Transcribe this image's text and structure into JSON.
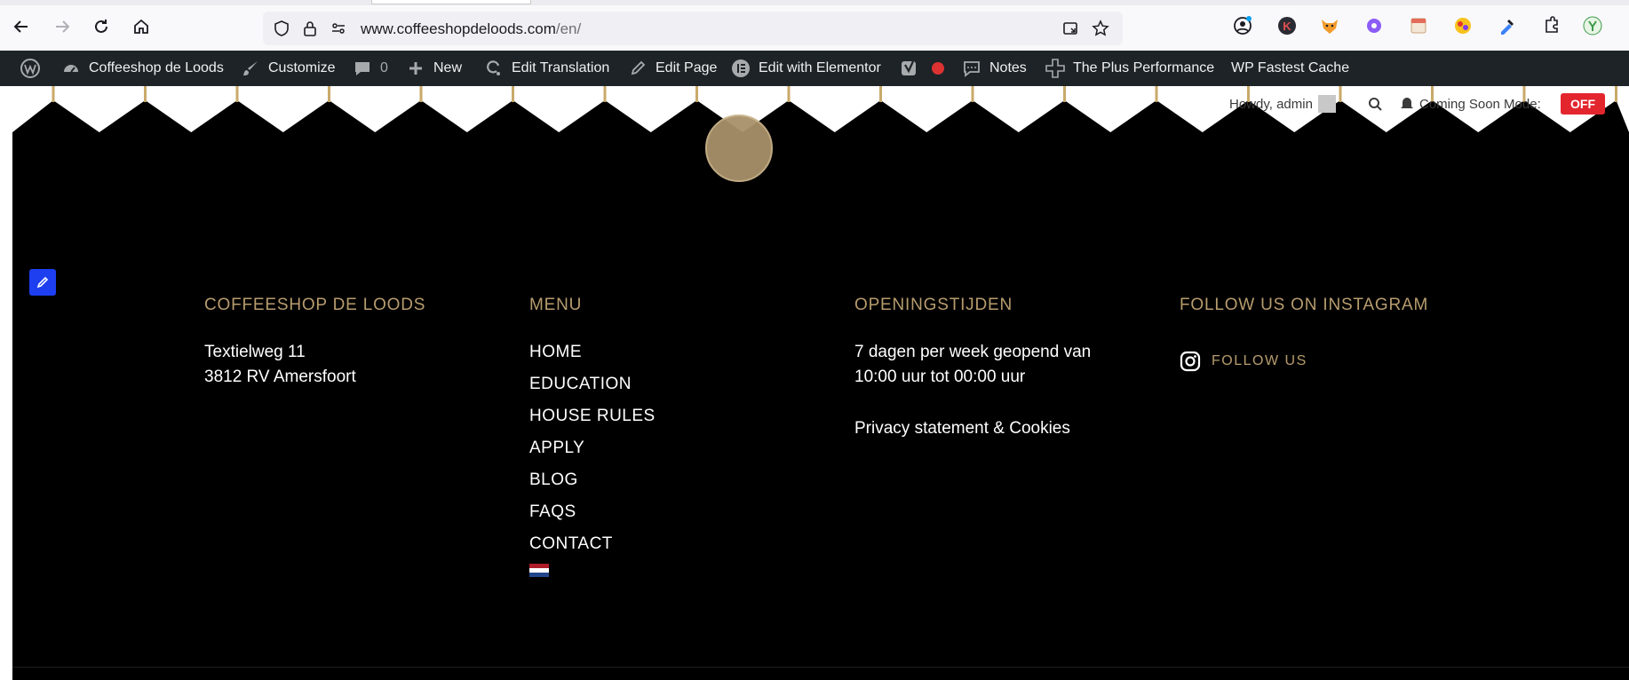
{
  "browser": {
    "url_host": "www.coffeeshopdeloods.com",
    "url_path": "/en/"
  },
  "adminbar": {
    "site_name": "Coffeeshop de Loods",
    "customize": "Customize",
    "comments_count": "0",
    "new": "New",
    "edit_translation": "Edit Translation",
    "edit_page": "Edit Page",
    "edit_with_elementor": "Edit with Elementor",
    "notes": "Notes",
    "plus_performance": "The Plus Performance",
    "fastest_cache": "WP Fastest Cache"
  },
  "overlay": {
    "howdy": "Howdy, admin",
    "coming_soon": "Coming Soon Mode:",
    "off": "OFF"
  },
  "footer": {
    "col1": {
      "heading": "COFFEESHOP DE LOODS",
      "line1": "Textielweg 11",
      "line2": "3812 RV Amersfoort"
    },
    "col2": {
      "heading": "MENU",
      "items": [
        "HOME",
        "EDUCATION",
        "HOUSE RULES",
        "APPLY",
        "BLOG",
        "FAQS",
        "CONTACT"
      ]
    },
    "col3": {
      "heading": "OPENINGSTIJDEN",
      "line1": "7 dagen per week geopend van",
      "line2": "10:00 uur tot 00:00 uur",
      "privacy": "Privacy statement & Cookies"
    },
    "col4": {
      "heading": "FOLLOW US ON INSTAGRAM",
      "follow": "FOLLOW US"
    }
  },
  "colors": {
    "gold": "#b79c6e",
    "admin_bar": "#1d2327",
    "off_badge": "#e3262e"
  }
}
